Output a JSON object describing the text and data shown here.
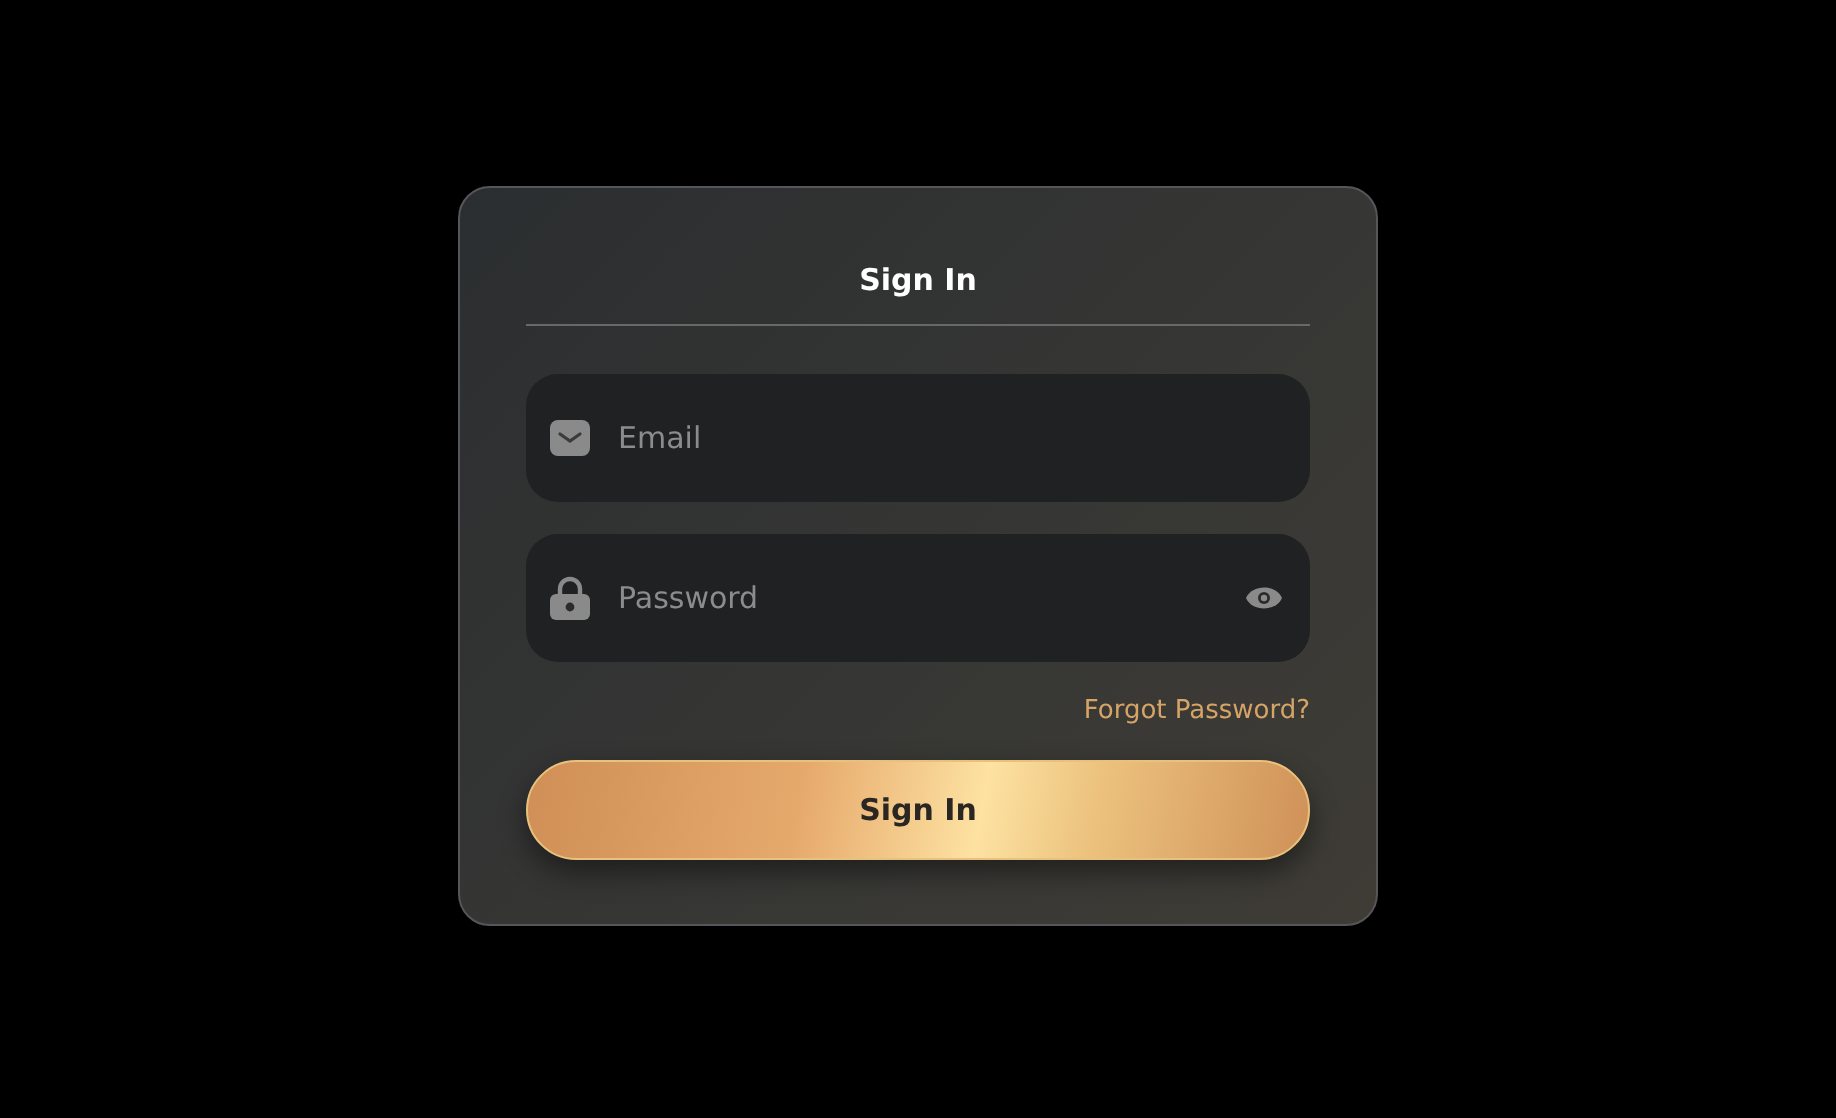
{
  "title": "Sign In",
  "fields": [
    {
      "kind": "email",
      "placeholder": "Email"
    },
    {
      "kind": "password",
      "placeholder": "Password"
    }
  ],
  "forgot_link": "Forgot Password?",
  "submit_button": "Sign In"
}
